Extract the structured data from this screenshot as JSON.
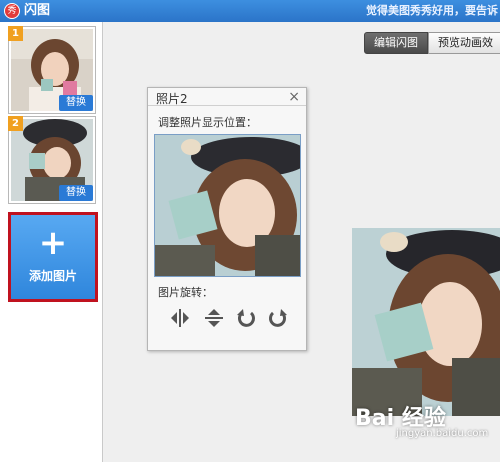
{
  "app": {
    "icon_glyph": "秀",
    "title": "闪图",
    "promo": "觉得美图秀秀好用，要告诉"
  },
  "sidebar": {
    "frames": [
      {
        "badge": "1",
        "replace_label": "替换"
      },
      {
        "badge": "2",
        "replace_label": "替换"
      }
    ],
    "add": {
      "plus": "+",
      "label": "添加图片"
    }
  },
  "tabs": [
    {
      "label": "编辑闪图",
      "active": true
    },
    {
      "label": "预览动画效",
      "active": false
    }
  ],
  "panel": {
    "title": "照片2",
    "close": "×",
    "adjust_label": "调整照片显示位置：",
    "rotate_label": "图片旋转：",
    "tools": [
      "flip-horizontal-icon",
      "flip-vertical-icon",
      "rotate-left-icon",
      "rotate-right-icon"
    ]
  },
  "watermark": {
    "text": "Bai 经验",
    "sub": "jingyan.baidu.com"
  },
  "colors": {
    "titlebar": "#2b74c8",
    "replace_button": "#2a7ad6",
    "add_button": "#3a90e2",
    "add_border": "#c0121f",
    "badge": "#f0a020"
  }
}
